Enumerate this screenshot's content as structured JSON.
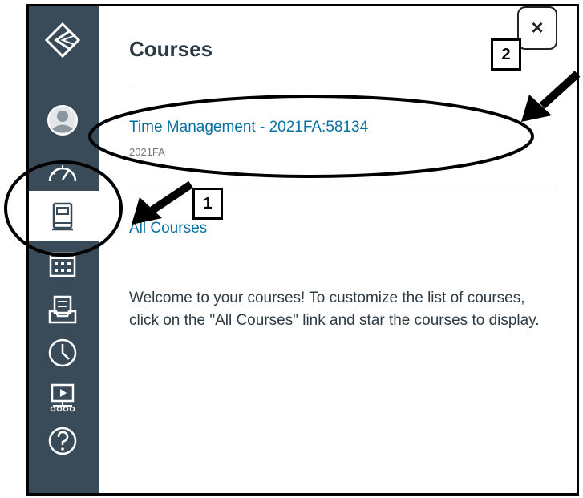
{
  "tray": {
    "title": "Courses",
    "course": {
      "name": "Time Management - 2021FA:58134",
      "term": "2021FA"
    },
    "all_courses_link": "All Courses",
    "welcome_text": "Welcome to your courses! To customize the list of courses, click on the \"All Courses\" link and star the courses to display."
  },
  "close_label": "×",
  "callouts": {
    "one": "1",
    "two": "2"
  },
  "sidebar": {
    "items": [
      {
        "name": "logo",
        "icon": "canvas-logo-icon"
      },
      {
        "name": "account",
        "icon": "user-icon"
      },
      {
        "name": "dashboard",
        "icon": "dashboard-icon"
      },
      {
        "name": "courses",
        "icon": "book-icon",
        "active": true
      },
      {
        "name": "calendar",
        "icon": "calendar-icon"
      },
      {
        "name": "inbox",
        "icon": "inbox-icon"
      },
      {
        "name": "history",
        "icon": "clock-icon"
      },
      {
        "name": "studio",
        "icon": "studio-icon"
      },
      {
        "name": "help",
        "icon": "help-icon"
      }
    ]
  },
  "colors": {
    "sidebar": "#394B58",
    "link": "#0770A3",
    "text": "#2D3B45",
    "divider": "#c7cdd1"
  }
}
